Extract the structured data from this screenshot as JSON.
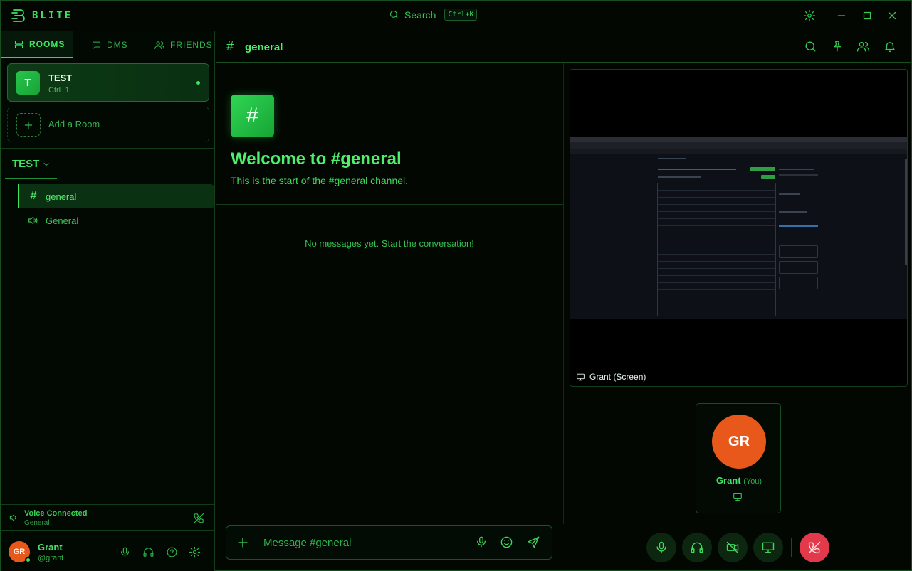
{
  "app": {
    "name": "BLITE"
  },
  "search": {
    "label": "Search",
    "shortcut": "Ctrl+K"
  },
  "sidebar": {
    "tabs": [
      {
        "label": "ROOMS",
        "icon": "rooms-icon",
        "active": true
      },
      {
        "label": "DMS",
        "icon": "message-icon",
        "active": false
      },
      {
        "label": "FRIENDS",
        "icon": "friends-icon",
        "active": false
      }
    ],
    "rooms": [
      {
        "initial": "T",
        "name": "TEST",
        "shortcut": "Ctrl+1",
        "online": true
      }
    ],
    "add_room_label": "Add a Room",
    "current_room": "TEST",
    "channels": [
      {
        "type": "text",
        "name": "general",
        "active": true
      },
      {
        "type": "voice",
        "name": "General",
        "active": false
      }
    ],
    "voice": {
      "title": "Voice Connected",
      "channel": "General"
    },
    "user": {
      "initials": "GR",
      "name": "Grant",
      "handle": "@grant",
      "status_color": "#3ee45f"
    }
  },
  "channel": {
    "hash": "#",
    "name": "general"
  },
  "chat": {
    "welcome_icon": "#",
    "welcome_title": "Welcome to #general",
    "welcome_subtitle": "This is the start of the #general channel.",
    "empty_message": "No messages yet. Start the conversation!",
    "composer_placeholder": "Message #general"
  },
  "voice_panel": {
    "screen_share_label": "Grant (Screen)",
    "participant": {
      "initials": "GR",
      "name": "Grant",
      "you_label": "(You)",
      "avatar_color": "#e8581a"
    }
  },
  "colors": {
    "accent": "#3ee461",
    "background": "#020702",
    "end_call": "#e23a4a"
  }
}
